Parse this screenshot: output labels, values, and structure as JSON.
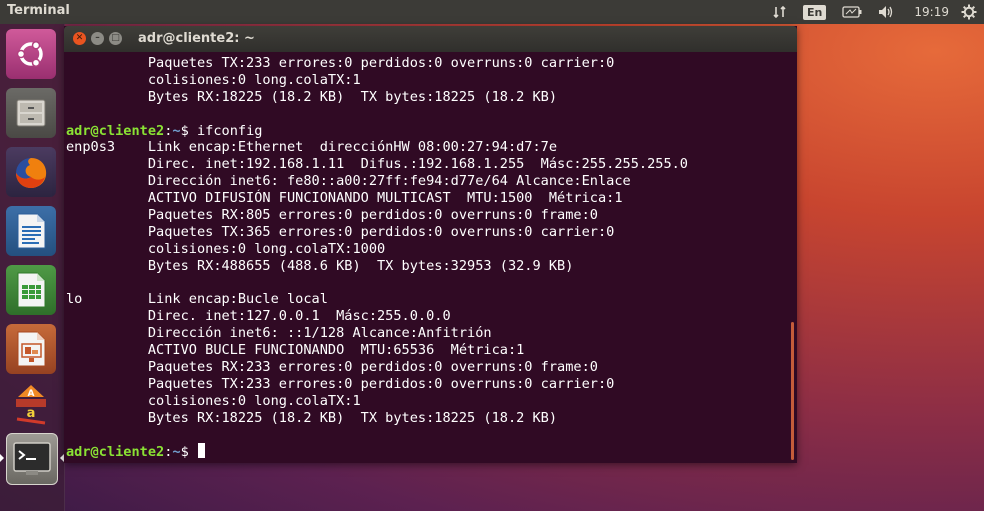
{
  "top_panel": {
    "app_title": "Terminal",
    "language": "En",
    "clock": "19:19"
  },
  "window": {
    "title": "adr@cliente2: ~"
  },
  "terminal": {
    "prompt_user": "adr@cliente2",
    "prompt_sep": ":",
    "prompt_path": "~",
    "prompt_dollar": "$",
    "lines": [
      {
        "kind": "out",
        "text": "          Paquetes TX:233 errores:0 perdidos:0 overruns:0 carrier:0"
      },
      {
        "kind": "out",
        "text": "          colisiones:0 long.colaTX:1"
      },
      {
        "kind": "out",
        "text": "          Bytes RX:18225 (18.2 KB)  TX bytes:18225 (18.2 KB)"
      },
      {
        "kind": "out",
        "text": ""
      },
      {
        "kind": "prompt",
        "command": " ifconfig"
      },
      {
        "kind": "out",
        "text": "enp0s3    Link encap:Ethernet  direcciónHW 08:00:27:94:d7:7e"
      },
      {
        "kind": "out",
        "text": "          Direc. inet:192.168.1.11  Difus.:192.168.1.255  Másc:255.255.255.0"
      },
      {
        "kind": "out",
        "text": "          Dirección inet6: fe80::a00:27ff:fe94:d77e/64 Alcance:Enlace"
      },
      {
        "kind": "out",
        "text": "          ACTIVO DIFUSIÓN FUNCIONANDO MULTICAST  MTU:1500  Métrica:1"
      },
      {
        "kind": "out",
        "text": "          Paquetes RX:805 errores:0 perdidos:0 overruns:0 frame:0"
      },
      {
        "kind": "out",
        "text": "          Paquetes TX:365 errores:0 perdidos:0 overruns:0 carrier:0"
      },
      {
        "kind": "out",
        "text": "          colisiones:0 long.colaTX:1000"
      },
      {
        "kind": "out",
        "text": "          Bytes RX:488655 (488.6 KB)  TX bytes:32953 (32.9 KB)"
      },
      {
        "kind": "out",
        "text": ""
      },
      {
        "kind": "out",
        "text": "lo        Link encap:Bucle local"
      },
      {
        "kind": "out",
        "text": "          Direc. inet:127.0.0.1  Másc:255.0.0.0"
      },
      {
        "kind": "out",
        "text": "          Dirección inet6: ::1/128 Alcance:Anfitrión"
      },
      {
        "kind": "out",
        "text": "          ACTIVO BUCLE FUNCIONANDO  MTU:65536  Métrica:1"
      },
      {
        "kind": "out",
        "text": "          Paquetes RX:233 errores:0 perdidos:0 overruns:0 frame:0"
      },
      {
        "kind": "out",
        "text": "          Paquetes TX:233 errores:0 perdidos:0 overruns:0 carrier:0"
      },
      {
        "kind": "out",
        "text": "          colisiones:0 long.colaTX:1"
      },
      {
        "kind": "out",
        "text": "          Bytes RX:18225 (18.2 KB)  TX bytes:18225 (18.2 KB)"
      },
      {
        "kind": "out",
        "text": ""
      },
      {
        "kind": "prompt",
        "command": " ",
        "cursor": true
      }
    ]
  },
  "launcher": {
    "items": [
      {
        "name": "ubuntu-dash-icon",
        "color": "#c04a8a"
      },
      {
        "name": "files-icon",
        "color": "#8a8680"
      },
      {
        "name": "firefox-icon",
        "color": "#e66000"
      },
      {
        "name": "libreoffice-writer-icon",
        "color": "#2a6db5"
      },
      {
        "name": "libreoffice-calc-icon",
        "color": "#3a9a3a"
      },
      {
        "name": "libreoffice-impress-icon",
        "color": "#c4572a"
      },
      {
        "name": "software-center-icon",
        "color": "#e07a20"
      },
      {
        "name": "terminal-icon",
        "color": "#2c2c2c"
      }
    ]
  },
  "colors": {
    "terminal_bg": "#300a24",
    "prompt_user": "#8ae234",
    "prompt_path": "#729fcf",
    "accent": "#e95420"
  }
}
